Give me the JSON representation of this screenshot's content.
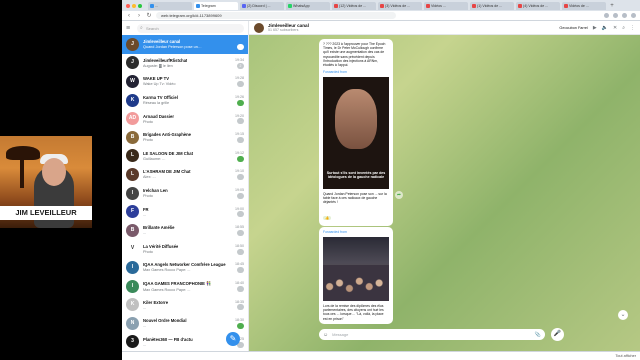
{
  "webcam": {
    "name": "JIM LEVEILLEUR"
  },
  "browser": {
    "tabs": [
      {
        "label": "...",
        "color": "#3390ec"
      },
      {
        "label": "Telegram",
        "color": "#3390ec",
        "active": true
      },
      {
        "label": "(2) Discord | ...",
        "color": "#5865f2"
      },
      {
        "label": "WhatsApp",
        "color": "#25d366"
      },
      {
        "label": "(12) Vidéos de ...",
        "color": "#e64545"
      },
      {
        "label": "(3) Vidéos de ...",
        "color": "#e64545"
      },
      {
        "label": "Vidéos ...",
        "color": "#e64545"
      },
      {
        "label": "(1) Vidéos de ...",
        "color": "#e64545"
      },
      {
        "label": "(4) Vidéos de ...",
        "color": "#e64545"
      },
      {
        "label": "Vidéos de ...",
        "color": "#e64545"
      }
    ],
    "url": "web.telegram.org/k/#-1173899609"
  },
  "sidebar": {
    "search_placeholder": "Search",
    "chats": [
      {
        "name": "Jimleveilleur canal",
        "msg": "Quand Jordan Peterson pose un…",
        "time": "",
        "badge": "",
        "color": "#6b4a2b",
        "initial": "J",
        "selected": true
      },
      {
        "name": "JimleveilleurfRlistchat",
        "msg": "Auguste: ▓ le lien",
        "time": "19:34",
        "badge": "2",
        "color": "#2c2c2c",
        "initial": "J"
      },
      {
        "name": "WAKE UP TV",
        "msg": "Wake Up Tv: Vidéo",
        "time": "19:28",
        "badge": "",
        "color": "#222233",
        "initial": "W"
      },
      {
        "name": "Karma TV Officiel",
        "msg": "Réseau la grille",
        "time": "19:26",
        "badge": "",
        "color": "#1e3a8a",
        "initial": "K",
        "green": true
      },
      {
        "name": "Arnaud Dassier",
        "msg": "Photo",
        "time": "19:20",
        "badge": "",
        "color": "#f29b9b",
        "initial": "AD"
      },
      {
        "name": "Brigades Anti-Graphène",
        "msg": "Photo",
        "time": "19:15",
        "badge": "",
        "color": "#8a6a3a",
        "initial": "B"
      },
      {
        "name": "LE SALOON DE JIM Chat",
        "msg": "Guillaume: ...",
        "time": "19:12",
        "badge": "",
        "color": "#3a2a1a",
        "initial": "L",
        "green": true
      },
      {
        "name": "L'ASHRAM DE JIM Chat",
        "msg": "Alex: ...",
        "time": "19:10",
        "badge": "",
        "color": "#5a3a2a",
        "initial": "L"
      },
      {
        "name": "Irelchan Len",
        "msg": "Photo",
        "time": "19:05",
        "badge": "",
        "color": "#444444",
        "initial": "I"
      },
      {
        "name": "FR",
        "msg": "...",
        "time": "19:00",
        "badge": "",
        "color": "#2d3e9a",
        "initial": "F"
      },
      {
        "name": "Brillante Amélie",
        "msg": "...",
        "time": "18:55",
        "badge": "",
        "color": "#7a5a6a",
        "initial": "B"
      },
      {
        "name": "La Vérité Diffusée",
        "msg": "Photo",
        "time": "18:50",
        "badge": "",
        "color": "#ffffff",
        "initial": "V"
      },
      {
        "name": "IQAA Angels Networker Comfrère League",
        "msg": "Max Games Rocco Pape: ...",
        "time": "18:45",
        "badge": "",
        "color": "#2a6a9a",
        "initial": "I"
      },
      {
        "name": "IQAA GAMES FRANCOPHONIE 👫",
        "msg": "Max Games Rocco Pape: ...",
        "time": "18:40",
        "badge": "",
        "color": "#3a8a5a",
        "initial": "I"
      },
      {
        "name": "Kiler Extorre",
        "msg": "...",
        "time": "18:35",
        "badge": "",
        "color": "#c0c0c0",
        "initial": "K"
      },
      {
        "name": "Nouvel Ordre Mondial",
        "msg": "...",
        "time": "18:30",
        "badge": "",
        "color": "#8aa0b0",
        "initial": "N",
        "green": true
      },
      {
        "name": "Planètes360 — FB d'actu",
        "msg": "...",
        "time": "18:25",
        "badge": "",
        "color": "#1a1a1a",
        "initial": "3"
      }
    ]
  },
  "chat": {
    "title": "Jimleveilleur canal",
    "subtitle": "51 657 subscribers",
    "voice_label": "Geocubon Farrel",
    "voice_sub": "",
    "posts": [
      {
        "text": "? ??? 2023 à l'approuver pour The Epoch Times, le Dr Peter McCullough confirme qu'il existe une augmentation des cas de myocardite sans précédent depuis l'introduction des injections à ARNm, étudiés à l'appui.",
        "fwd": "",
        "img_caption": "",
        "meta": ""
      },
      {
        "text": "Quand Jordan Peterson pose son ... sur la table face à ces radicaux de gauche déjantés !",
        "fwd": "Forwarded from",
        "img_caption": "Surtout s'ils sont inventés par des idéologues de la gauche radicale",
        "meta": ""
      },
      {
        "text": "Lors de la remise des diplômes des élus parlementaires, des citoyens ont hué les tous ces ... lorsque ... \"Là, voilà, la place est en prison\"",
        "fwd": "Forwarded from",
        "img_caption": "",
        "meta": ""
      }
    ],
    "composer_placeholder": "Message"
  },
  "downloads": {
    "file": "",
    "all": "Tout afficher"
  }
}
